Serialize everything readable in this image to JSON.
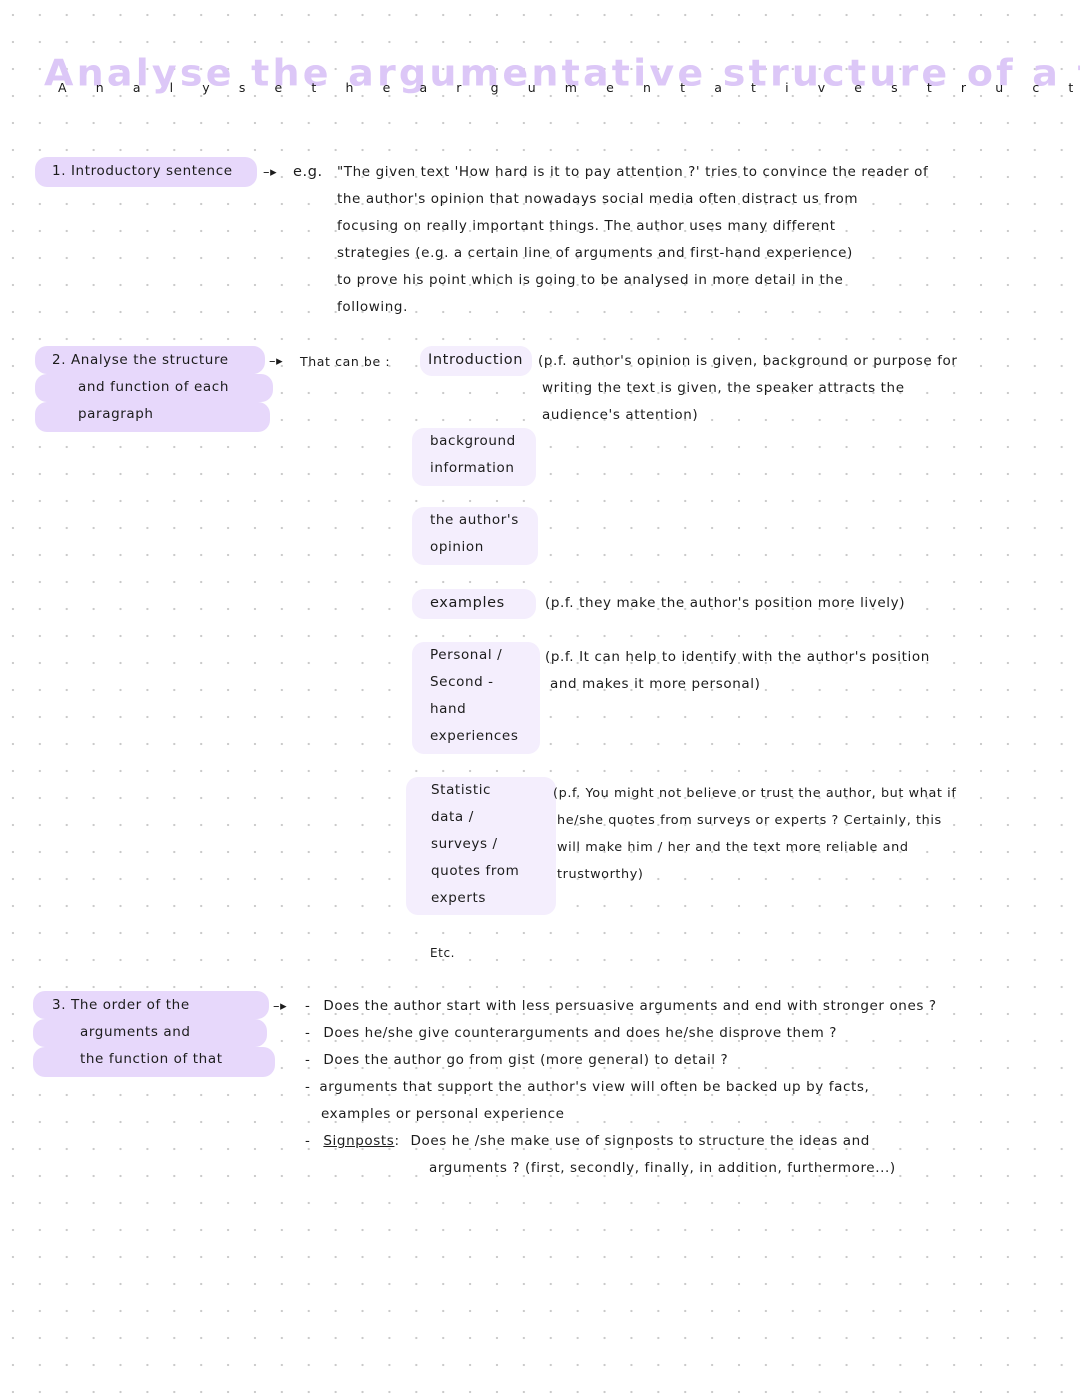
{
  "title": {
    "display": "Analyse the argumentative structure of a text",
    "spaced": "A n a l y s e   t h e   a r g u m e n t a t i v e   s t r u c t u r e   o f   a   t e x t"
  },
  "colors": {
    "highlight_strong": "#e7d8fb",
    "highlight_light": "#f4eefd",
    "title_lavender": "#dcc7f7",
    "ink": "#1c1c1c"
  },
  "section1": {
    "label": "1. Introductory sentence",
    "arrow": "–▸",
    "eg": "e.g.",
    "lines": [
      "\"The given text 'How hard is it to pay attention ?' tries to convince the reader of",
      "the author's opinion that nowadays social media often distract us from",
      "focusing on really important things. The author uses many different",
      "strategies (e.g. a certain line of arguments and first-hand experience)",
      "to prove his point which is going to be analysed in more detail in the",
      "following."
    ]
  },
  "section2": {
    "label_lines": [
      "2. Analyse the structure",
      "and function of each",
      "paragraph"
    ],
    "arrow": "–▸",
    "that_can_be": "That can be :",
    "items": [
      {
        "term_lines": [
          "Introduction"
        ],
        "note_lines": [
          "(p.f. author's opinion is given, background or purpose for",
          "writing the text is given, the speaker attracts the",
          "audience's attention)"
        ]
      },
      {
        "term_lines": [
          "background",
          "information"
        ],
        "note_lines": []
      },
      {
        "term_lines": [
          "the author's",
          "opinion"
        ],
        "note_lines": []
      },
      {
        "term_lines": [
          "examples"
        ],
        "note_lines": [
          "(p.f. they make the author's position more lively)"
        ]
      },
      {
        "term_lines": [
          "Personal /",
          "Second -",
          "hand",
          "experiences"
        ],
        "note_lines": [
          "(p.f. It can help to identify with the author's position",
          "and makes it more personal)"
        ]
      },
      {
        "term_lines": [
          "Statistic",
          "data /",
          "surveys /",
          "quotes from",
          "experts"
        ],
        "note_lines": [
          "(p.f. You might not believe or trust the author, but what if",
          "he/she quotes from surveys or experts ? Certainly, this",
          "will make him / her and the text more reliable and",
          "trustworthy)"
        ]
      }
    ],
    "etc": "Etc."
  },
  "section3": {
    "label_lines": [
      "3. The order of the",
      "arguments and",
      "the function of that"
    ],
    "arrow": "–▸",
    "bullets": [
      {
        "lines": [
          "Does the author start with less persuasive arguments and end with stronger ones ?"
        ]
      },
      {
        "lines": [
          "Does he/she give counterarguments and does he/she disprove them ?"
        ]
      },
      {
        "lines": [
          "Does the author go from gist (more general) to detail ?"
        ]
      },
      {
        "lines": [
          "arguments that support the author's view will often be backed up by facts,",
          "examples or personal experience"
        ]
      }
    ],
    "signposts": {
      "label": "Signposts",
      "colon": ":",
      "lines": [
        "Does he /she make use of signposts to structure the ideas and",
        "arguments ? (first, secondly, finally, in addition, furthermore...)"
      ]
    },
    "dash": "-"
  }
}
